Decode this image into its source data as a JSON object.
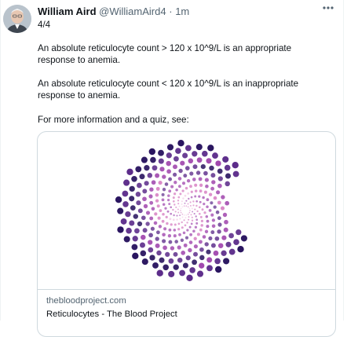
{
  "tweet": {
    "author_name": "William Aird",
    "handle": "@WilliamAird4",
    "separator": "·",
    "time": "1m",
    "more_icon": "more-horizontal-icon",
    "paragraphs": [
      "4/4",
      "An absolute reticulocyte count > 120 x 10^9/L is an appropriate response to anemia.",
      "An absolute reticulocyte count < 120 x 10^9/L is an inappropriate response to anemia.",
      "For more information and a quiz, see:"
    ]
  },
  "link_card": {
    "domain": "thebloodproject.com",
    "title": "Reticulocytes - The Blood Project",
    "image": "spiral-dots-logo",
    "colors": [
      "#2a1560",
      "#5c2c8a",
      "#9a3aa8",
      "#d06ab8",
      "#f0bfe0"
    ]
  }
}
